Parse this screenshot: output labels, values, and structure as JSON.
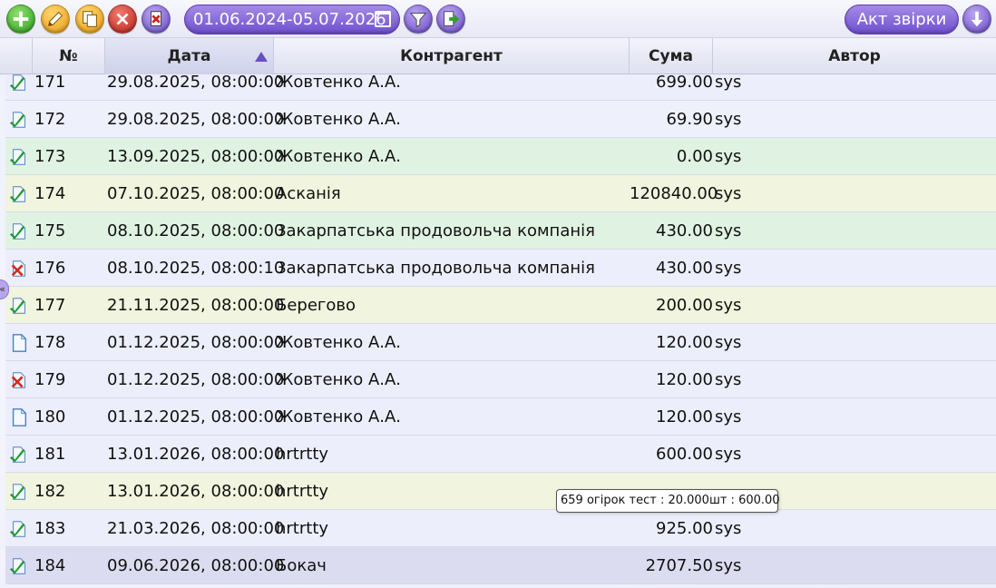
{
  "toolbar": {
    "buttons": [
      {
        "icon": "add-icon",
        "color": "#3aa82a"
      },
      {
        "icon": "pencil-icon",
        "color": "#e89a12"
      },
      {
        "icon": "copy-icon",
        "color": "#e89a12"
      },
      {
        "icon": "close-icon",
        "color": "#b8231a"
      },
      {
        "icon": "delete-document-icon",
        "color": "#6b4bc8"
      }
    ],
    "date_range": "01.06.2024-05.07.2026",
    "act_button_label": "Акт звірки",
    "accent_color": "#6f4fce"
  },
  "grid": {
    "columns": {
      "num": "№",
      "date": "Дата",
      "counterparty": "Контрагент",
      "sum": "Сума",
      "author": "Автор"
    },
    "sorted_column": "date",
    "sort_direction": "ascending",
    "rows": [
      {
        "status": "approved",
        "num": "171",
        "date": "29.08.2025, 08:00:00",
        "counterparty": "Жовтенко А.А.",
        "sum": "699.00",
        "author": "sys",
        "bg": "#eceefb"
      },
      {
        "status": "approved",
        "num": "172",
        "date": "29.08.2025, 08:00:00",
        "counterparty": "Жовтенко А.А.",
        "sum": "69.90",
        "author": "sys",
        "bg": "#eef0fb"
      },
      {
        "status": "approved",
        "num": "173",
        "date": "13.09.2025, 08:00:00",
        "counterparty": "Жовтенко А.А.",
        "sum": "0.00",
        "author": "sys",
        "bg": "#e0f3e2"
      },
      {
        "status": "approved",
        "num": "174",
        "date": "07.10.2025, 08:00:00",
        "counterparty": "Асканія",
        "sum": "120840.00",
        "author": "sys",
        "bg": "#f1f4de"
      },
      {
        "status": "approved",
        "num": "175",
        "date": "08.10.2025, 08:00:00",
        "counterparty": "Закарпатська продовольча компанія",
        "sum": "430.00",
        "author": "sys",
        "bg": "#e0f3e2"
      },
      {
        "status": "cancelled",
        "num": "176",
        "date": "08.10.2025, 08:00:10",
        "counterparty": "Закарпатська продовольча компанія",
        "sum": "430.00",
        "author": "sys",
        "bg": "#eceefb"
      },
      {
        "status": "approved",
        "num": "177",
        "date": "21.11.2025, 08:00:00",
        "counterparty": "Берегово",
        "sum": "200.00",
        "author": "sys",
        "bg": "#f1f4de"
      },
      {
        "status": "draft",
        "num": "178",
        "date": "01.12.2025, 08:00:00",
        "counterparty": "Жовтенко А.А.",
        "sum": "120.00",
        "author": "sys",
        "bg": "#eceefb"
      },
      {
        "status": "cancelled",
        "num": "179",
        "date": "01.12.2025, 08:00:00",
        "counterparty": "Жовтенко А.А.",
        "sum": "120.00",
        "author": "sys",
        "bg": "#eceefb"
      },
      {
        "status": "draft",
        "num": "180",
        "date": "01.12.2025, 08:00:00",
        "counterparty": "Жовтенко А.А.",
        "sum": "120.00",
        "author": "sys",
        "bg": "#eceefb"
      },
      {
        "status": "approved",
        "num": "181",
        "date": "13.01.2026, 08:00:00",
        "counterparty": "hrtrtty",
        "sum": "600.00",
        "author": "sys",
        "bg": "#eceefb"
      },
      {
        "status": "approved",
        "num": "182",
        "date": "13.01.2026, 08:00:00",
        "counterparty": "hrtrtty",
        "sum": "",
        "author": "",
        "bg": "#f1f4de"
      },
      {
        "status": "approved",
        "num": "183",
        "date": "21.03.2026, 08:00:00",
        "counterparty": "hrtrtty",
        "sum": "925.00",
        "author": "sys",
        "bg": "#eceefb"
      },
      {
        "status": "approved",
        "num": "184",
        "date": "09.06.2026, 08:00:00",
        "counterparty": "Бокач",
        "sum": "2707.50",
        "author": "sys",
        "bg": "#dcdcf1"
      }
    ]
  },
  "side_toggle": "«",
  "tooltip": "659 огірок тест :  20.000шт : 600.00"
}
